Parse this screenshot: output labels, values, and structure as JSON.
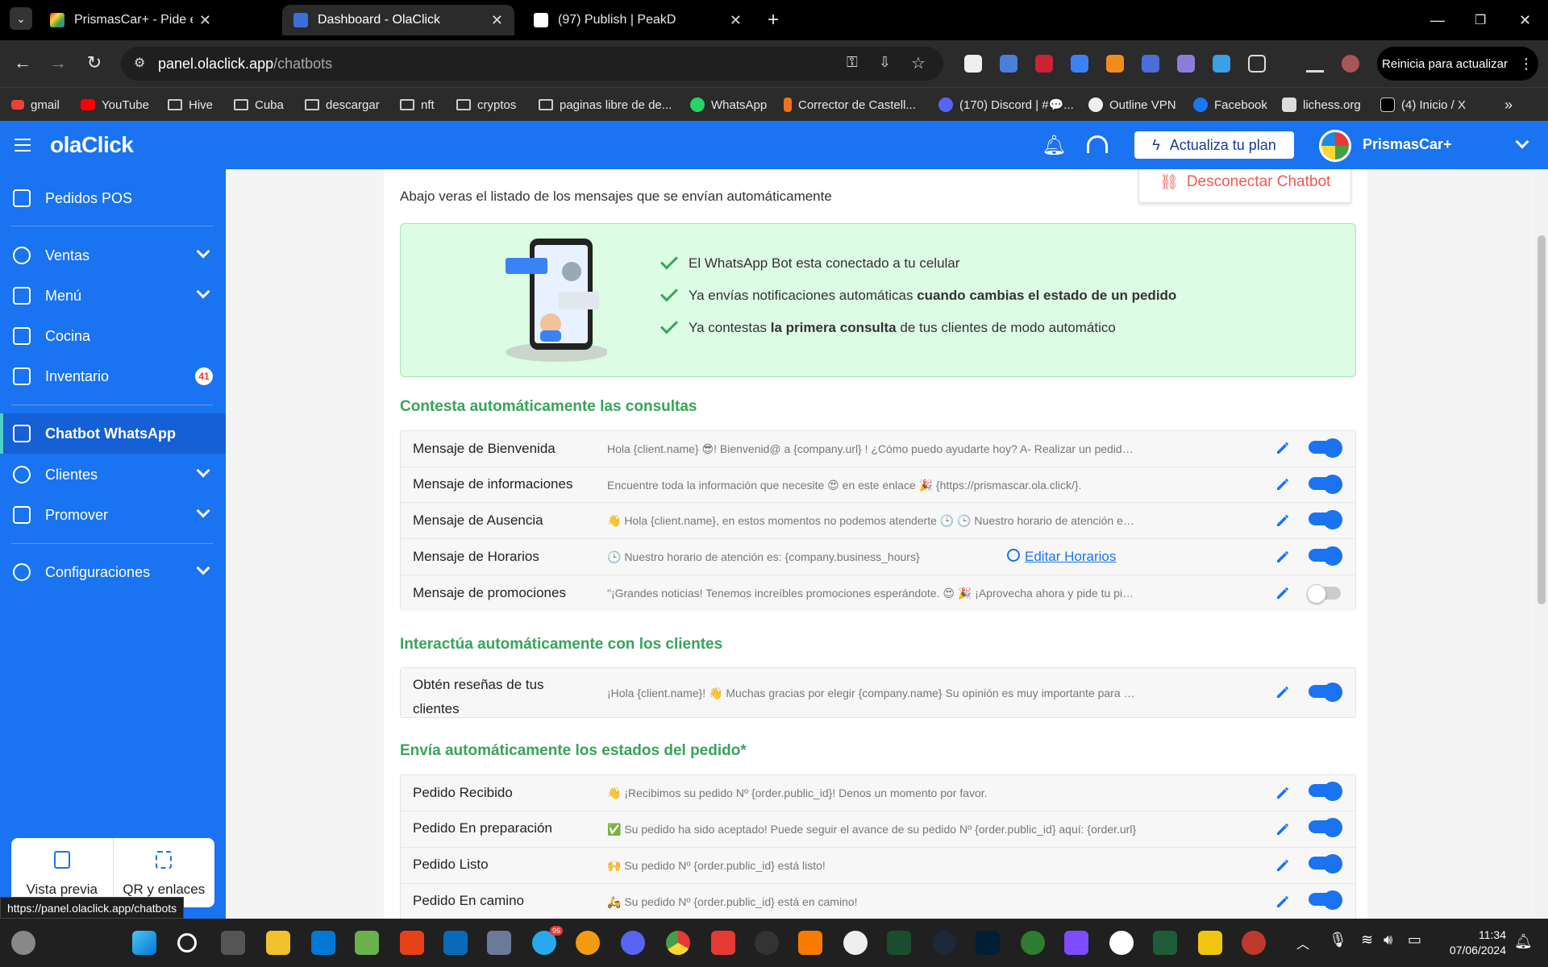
{
  "browser": {
    "tabs": [
      {
        "title": "PrismasCar+ - Pide en línea. Me",
        "active": false
      },
      {
        "title": "Dashboard - OlaClick",
        "active": true
      },
      {
        "title": "(97) Publish | PeakD",
        "active": false
      }
    ],
    "url_host": "panel.olaclick.app",
    "url_path": "/chatbots",
    "update_label": "Reinicia para actualizar",
    "bookmarks": [
      "gmail",
      "YouTube",
      "Hive",
      "Cuba",
      "descargar",
      "nft",
      "cryptos",
      "paginas libre de de...",
      "WhatsApp",
      "Corrector de Castell...",
      "(170) Discord | #💬...",
      "Outline VPN",
      "Facebook",
      "lichess.org",
      "(4) Inicio / X"
    ],
    "status_url": "https://panel.olaclick.app/chatbots"
  },
  "header": {
    "logo": "olaClick",
    "upgrade_label": "Actualiza tu plan",
    "account_name": "PrismasCar+"
  },
  "sidebar": {
    "items": [
      {
        "label": "Pedidos POS",
        "icon": "receipt-icon",
        "has_chevron": false
      },
      {
        "label": "Ventas",
        "icon": "dollar-icon",
        "has_chevron": true
      },
      {
        "label": "Menú",
        "icon": "menu-book-icon",
        "has_chevron": true
      },
      {
        "label": "Cocina",
        "icon": "kitchen-icon",
        "has_chevron": false
      },
      {
        "label": "Inventario",
        "icon": "clipboard-icon",
        "has_chevron": false,
        "badge": "41"
      },
      {
        "label": "Chatbot WhatsApp",
        "icon": "robot-icon",
        "has_chevron": false,
        "active": true
      },
      {
        "label": "Clientes",
        "icon": "users-icon",
        "has_chevron": true
      },
      {
        "label": "Promover",
        "icon": "megaphone-icon",
        "has_chevron": true
      },
      {
        "label": "Configuraciones",
        "icon": "gear-icon",
        "has_chevron": true
      }
    ],
    "preview_label": "Vista previa",
    "qr_label": "QR y enlaces"
  },
  "main": {
    "intro": "Abajo veras el listado de los mensajes que se envían automáticamente",
    "disconnect_label": "Desconectar Chatbot",
    "banner": [
      {
        "pre": "El WhatsApp Bot esta conectado a tu celular",
        "bold": "",
        "post": ""
      },
      {
        "pre": "Ya envías notificaciones automáticas ",
        "bold": "cuando cambias el estado de un pedido",
        "post": ""
      },
      {
        "pre": "Ya contestas ",
        "bold": "la primera consulta",
        "post": " de tus clientes de modo automático"
      }
    ],
    "sections": [
      {
        "title": "Contesta automáticamente las consultas",
        "rows": [
          {
            "name": "Mensaje de Bienvenida",
            "message": "Hola {client.name} 😎! Bienvenid@ a {company.url} ! ¿Cómo puedo ayudarte hoy? A- Realizar un pedido 🚗 🚚 ...",
            "enabled": true
          },
          {
            "name": "Mensaje de informaciones",
            "message": "Encuentre toda la información que necesite 😍 en este enlace 🎉 {https://prismascar.ola.click/}.",
            "enabled": true
          },
          {
            "name": "Mensaje de Ausencia",
            "message": "👋 Hola {client.name}, en estos momentos no podemos atenderte 🕒 🕒 Nuestro horario de atención es: {co...",
            "enabled": true
          },
          {
            "name": "Mensaje de Horarios",
            "message": "🕒 Nuestro horario de atención es: {company.business_hours}",
            "enabled": true,
            "link": "Editar Horarios"
          },
          {
            "name": "Mensaje de promociones",
            "message": "\"¡Grandes noticias! Tenemos increíbles promociones esperándote. 😍 🎉 ¡Aprovecha ahora y pide tu pieza favo...",
            "enabled": false
          }
        ]
      },
      {
        "title": "Interactúa automáticamente con los clientes",
        "rows": [
          {
            "name": "Obtén reseñas de tus clientes",
            "message": "¡Hola {client.name}! 👋 Muchas gracias por elegir {company.name} Su opinión es muy importante para nosotro...",
            "enabled": true
          }
        ]
      },
      {
        "title": "Envía automáticamente los estados del pedido*",
        "rows": [
          {
            "name": "Pedido Recibido",
            "message": "👋 ¡Recibimos su pedido Nº {order.public_id}! Denos un momento por favor.",
            "enabled": true
          },
          {
            "name": "Pedido En preparación",
            "message": "✅ Su pedido ha sido aceptado! Puede seguir el avance de su pedido Nº {order.public_id} aquí: {order.url}",
            "enabled": true
          },
          {
            "name": "Pedido Listo",
            "message": "🙌 Su pedido Nº {order.public_id} está listo!",
            "enabled": true
          },
          {
            "name": "Pedido En camino",
            "message": "🛵 Su pedido Nº {order.public_id} está en camino!",
            "enabled": true
          }
        ]
      }
    ]
  },
  "taskbar": {
    "time": "11:34",
    "date": "07/06/2024",
    "telegram_badge": "96"
  },
  "colors": {
    "brand_blue": "#1a73f0",
    "success_green": "#38a35a",
    "banner_bg": "#dcfce4",
    "danger": "#f05a50"
  }
}
